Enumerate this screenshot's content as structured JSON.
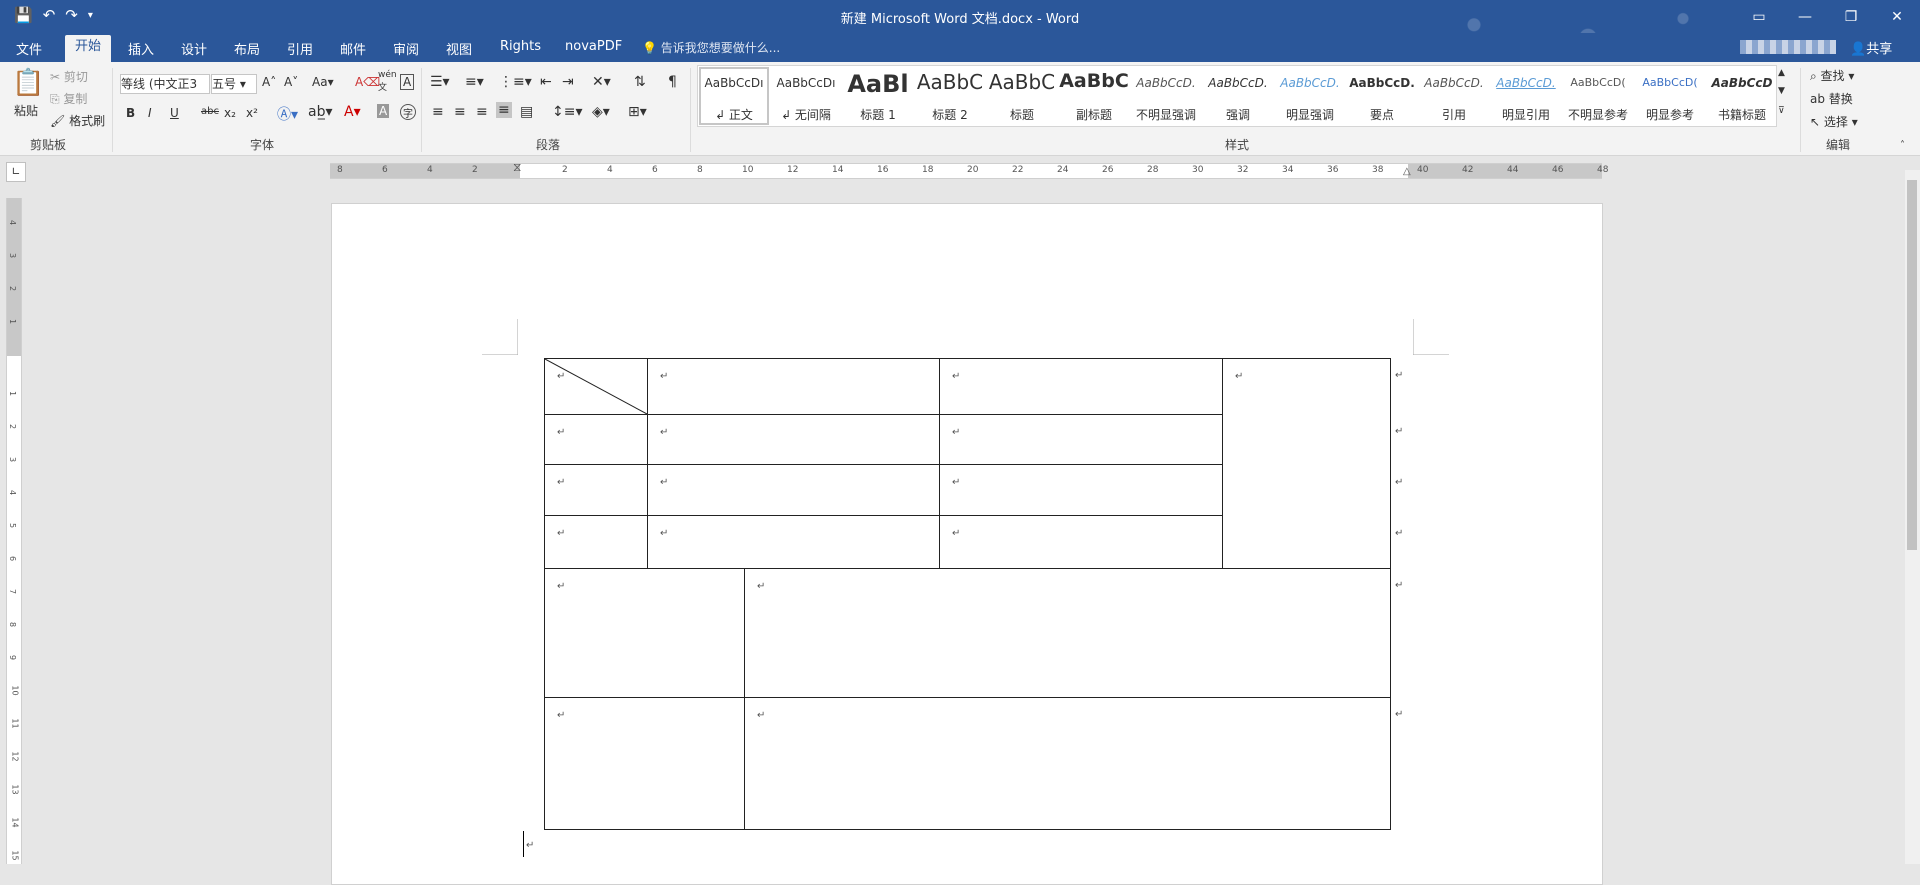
{
  "window": {
    "title": "新建 Microsoft Word 文档.docx - Word"
  },
  "tabs": [
    {
      "label": "文件"
    },
    {
      "label": "开始"
    },
    {
      "label": "插入"
    },
    {
      "label": "设计"
    },
    {
      "label": "布局"
    },
    {
      "label": "引用"
    },
    {
      "label": "邮件"
    },
    {
      "label": "审阅"
    },
    {
      "label": "视图"
    },
    {
      "label": "Rights"
    },
    {
      "label": "novaPDF"
    }
  ],
  "tell_me": "告诉我您想要做什么...",
  "share": "共享",
  "clipboard": {
    "paste": "粘贴",
    "cut": "剪切",
    "copy": "复制",
    "format_painter": "格式刷",
    "group": "剪贴板"
  },
  "font": {
    "name": "等线 (中文正3",
    "size": "五号",
    "group": "字体",
    "aa": "Aa",
    "bold": "B",
    "italic": "I",
    "underline": "U",
    "strike": "abc",
    "sub": "x₂",
    "sup": "x²",
    "font_color_a": "A",
    "phonetic": "wén",
    "phonetic2": "文"
  },
  "paragraph": {
    "group": "段落"
  },
  "styles": {
    "group": "样式",
    "items": [
      {
        "sample": "AaBbCcDı",
        "name": "↲ 正文"
      },
      {
        "sample": "AaBbCcDı",
        "name": "↲ 无间隔"
      },
      {
        "sample": "AaBl",
        "name": "标题 1"
      },
      {
        "sample": "AaBbC",
        "name": "标题 2"
      },
      {
        "sample": "AaBbC",
        "name": "标题"
      },
      {
        "sample": "AaBbC",
        "name": "副标题"
      },
      {
        "sample": "AaBbCcD.",
        "name": "不明显强调"
      },
      {
        "sample": "AaBbCcD.",
        "name": "强调"
      },
      {
        "sample": "AaBbCcD.",
        "name": "明显强调"
      },
      {
        "sample": "AaBbCcD.",
        "name": "要点"
      },
      {
        "sample": "AaBbCcD.",
        "name": "引用"
      },
      {
        "sample": "AaBbCcD.",
        "name": "明显引用"
      },
      {
        "sample": "AaBbCcD(",
        "name": "不明显参考"
      },
      {
        "sample": "AaBbCcD(",
        "name": "明显参考"
      },
      {
        "sample": "AaBbCcD",
        "name": "书籍标题"
      }
    ]
  },
  "editing": {
    "find": "查找",
    "replace": "替换",
    "select": "选择",
    "group": "编辑"
  },
  "ruler": {
    "h_labels": [
      "8",
      "6",
      "4",
      "2",
      "2",
      "4",
      "6",
      "8",
      "10",
      "12",
      "14",
      "16",
      "18",
      "20",
      "22",
      "24",
      "26",
      "28",
      "30",
      "32",
      "34",
      "36",
      "38",
      "40",
      "42",
      "44",
      "46",
      "48"
    ],
    "v_labels": [
      "4",
      "3",
      "2",
      "1",
      "1",
      "2",
      "3",
      "4",
      "5",
      "6",
      "7",
      "8",
      "9",
      "10",
      "11",
      "12",
      "13",
      "14",
      "15"
    ]
  },
  "doc": {
    "para_mark": "↵"
  }
}
